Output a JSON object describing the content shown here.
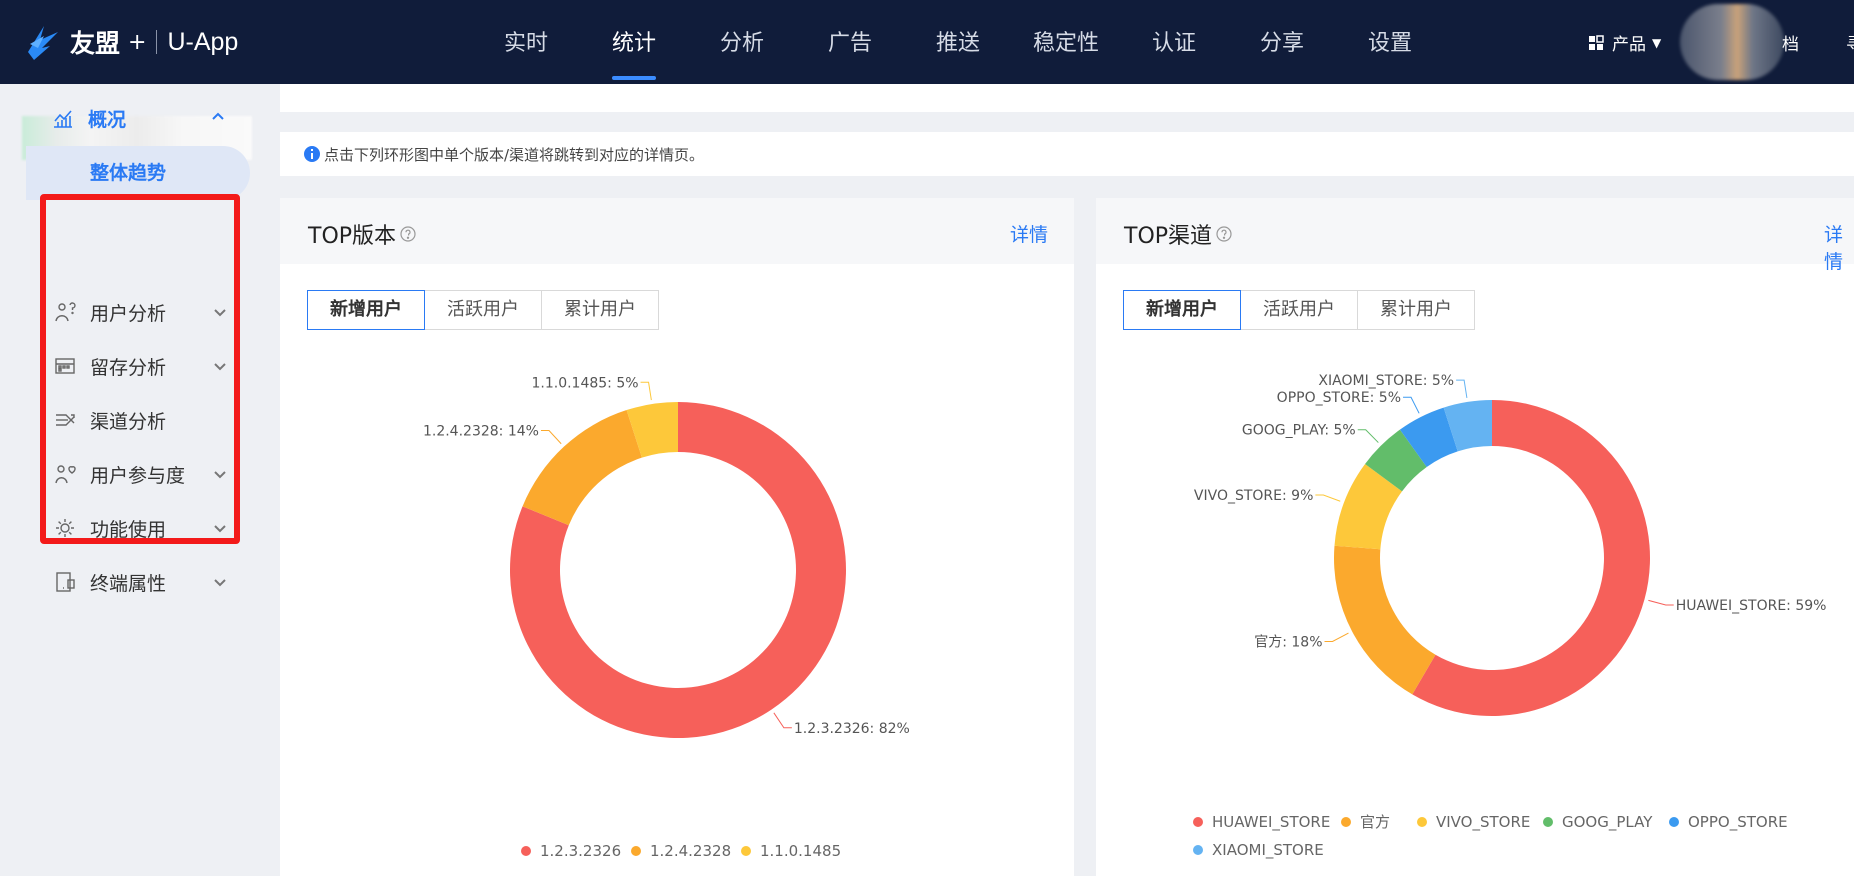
{
  "brand": {
    "name": "友盟",
    "plus": "+",
    "app": "U-App"
  },
  "nav": {
    "items": [
      "实时",
      "统计",
      "分析",
      "广告",
      "推送",
      "稳定性",
      "认证",
      "分享",
      "设置"
    ],
    "active_index": 1,
    "product_label": "产品",
    "docs_label": "档",
    "cut_label": "寻"
  },
  "sidebar": {
    "parent": "概况",
    "sub_active": "整体趋势",
    "items": [
      {
        "label": "用户分析",
        "icon": "user-analysis-icon",
        "expandable": true
      },
      {
        "label": "留存分析",
        "icon": "retention-grid-icon",
        "expandable": true
      },
      {
        "label": "渠道分析",
        "icon": "channel-flow-icon",
        "expandable": false
      },
      {
        "label": "用户参与度",
        "icon": "engagement-icon",
        "expandable": true
      },
      {
        "label": "功能使用",
        "icon": "gear-icon",
        "expandable": true
      },
      {
        "label": "终端属性",
        "icon": "device-icon",
        "expandable": true
      }
    ]
  },
  "info_bar": {
    "text": "点击下列环形图中单个版本/渠道将跳转到对应的详情页。"
  },
  "cards": {
    "version": {
      "title": "TOP版本",
      "detail": "详情",
      "tabs": [
        "新增用户",
        "活跃用户",
        "累计用户"
      ],
      "active_tab": 0
    },
    "channel": {
      "title": "TOP渠道",
      "detail": "详情",
      "tabs": [
        "新增用户",
        "活跃用户",
        "累计用户"
      ],
      "active_tab": 0
    }
  },
  "colors": {
    "red": "#f6605a",
    "orange": "#fba92d",
    "yellow": "#fdc83a",
    "green": "#62bd6a",
    "blue": "#3b9af0",
    "lightblue": "#64b3f2",
    "accent": "#2a7af4"
  },
  "chart_data": [
    {
      "type": "pie",
      "donut": true,
      "labels": [
        "1.2.3.2326",
        "1.2.4.2328",
        "1.1.0.1485"
      ],
      "values": [
        82,
        14,
        5
      ],
      "slice_labels": [
        "1.2.3.2326: 82%",
        "1.2.4.2328: 14%",
        "1.1.0.1485: 5%"
      ],
      "colors": [
        "#f6605a",
        "#fba92d",
        "#fdc83a"
      ],
      "legend": "bottom"
    },
    {
      "type": "pie",
      "donut": true,
      "labels": [
        "HUAWEI_STORE",
        "官方",
        "VIVO_STORE",
        "GOOG_PLAY",
        "OPPO_STORE",
        "XIAOMI_STORE"
      ],
      "values": [
        59,
        18,
        9,
        5,
        5,
        5
      ],
      "slice_labels": [
        "HUAWEI_STORE: 59%",
        "官方: 18%",
        "VIVO_STORE: 9%",
        "GOOG_PLAY: 5%",
        "OPPO_STORE: 5%",
        "XIAOMI_STORE: 5%"
      ],
      "colors": [
        "#f6605a",
        "#fba92d",
        "#fdc83a",
        "#62bd6a",
        "#3b9af0",
        "#64b3f2"
      ],
      "legend": "bottom"
    }
  ]
}
